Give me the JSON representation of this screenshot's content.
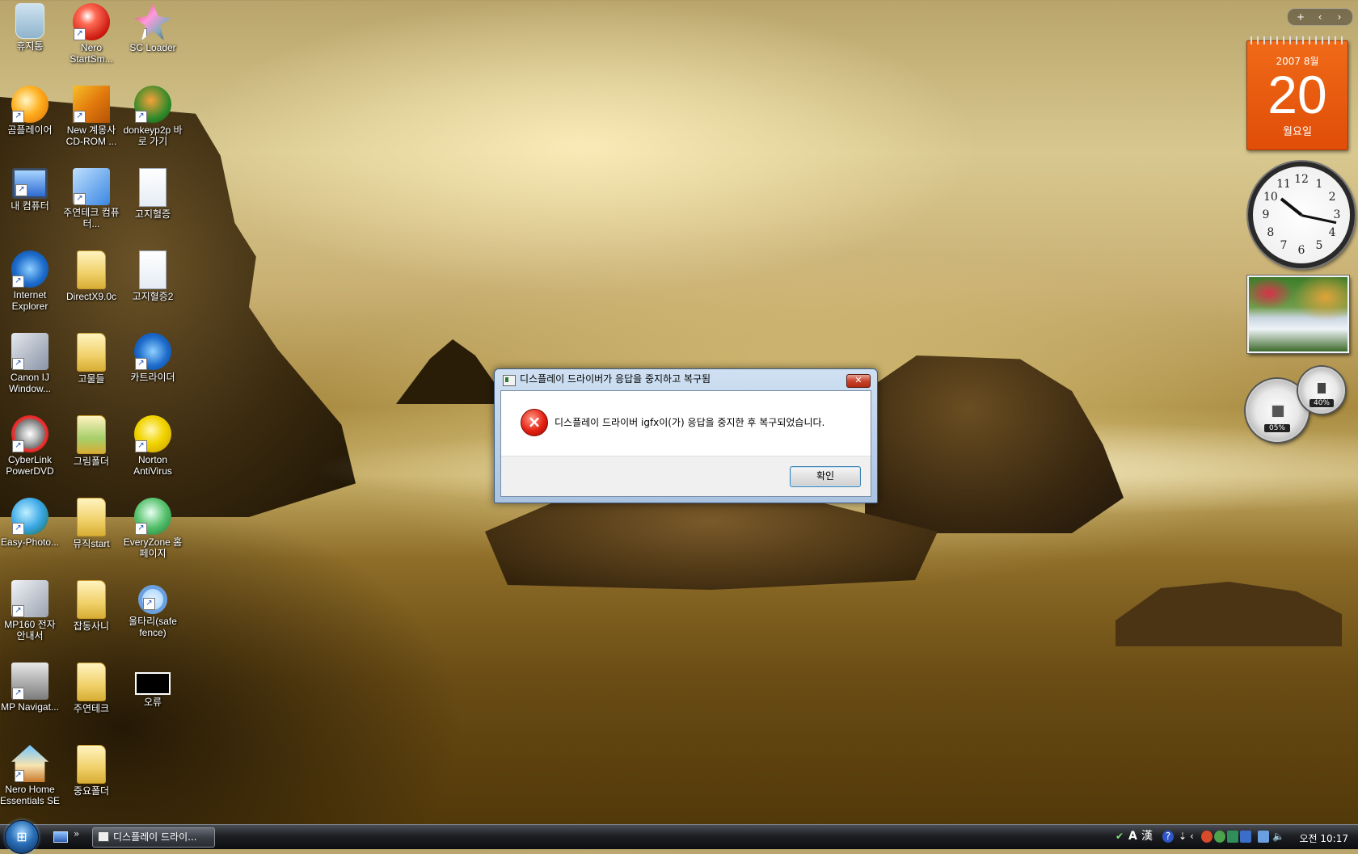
{
  "desktop": {
    "icons": [
      {
        "label": "휴지통",
        "glyph": "recycle-bin-icon"
      },
      {
        "label": "Nero StartSm...",
        "glyph": "nero-icon"
      },
      {
        "label": "SC Loader",
        "glyph": "sc-loader-icon"
      },
      {
        "label": "곰플레이어",
        "glyph": "gom-player-icon"
      },
      {
        "label": "New 계몽사 CD-ROM ...",
        "glyph": "cd-rom-icon"
      },
      {
        "label": "donkeyp2p 바로 가기",
        "glyph": "donkey-icon"
      },
      {
        "label": "내 컴퓨터",
        "glyph": "computer-icon"
      },
      {
        "label": "주연테크 컴퓨터...",
        "glyph": "help-icon"
      },
      {
        "label": "고지혈증",
        "glyph": "document-icon"
      },
      {
        "label": "Internet Explorer",
        "glyph": "internet-explorer-icon"
      },
      {
        "label": "DirectX9.0c",
        "glyph": "folder-icon"
      },
      {
        "label": "고지혈증2",
        "glyph": "document-icon"
      },
      {
        "label": "Canon IJ Window...",
        "glyph": "canon-printer-icon"
      },
      {
        "label": "고물들",
        "glyph": "folder-icon"
      },
      {
        "label": "카트라이더",
        "glyph": "internet-explorer-icon"
      },
      {
        "label": "CyberLink PowerDVD",
        "glyph": "cyberlink-icon"
      },
      {
        "label": "그림폴더",
        "glyph": "picture-folder-icon"
      },
      {
        "label": "Norton AntiVirus",
        "glyph": "norton-icon"
      },
      {
        "label": "Easy-Photo...",
        "glyph": "easy-photo-icon"
      },
      {
        "label": "뮤직start",
        "glyph": "folder-icon"
      },
      {
        "label": "EveryZone 홈페이지",
        "glyph": "everyzone-icon"
      },
      {
        "label": "MP160 전자 안내서",
        "glyph": "manual-icon"
      },
      {
        "label": "잡동사니",
        "glyph": "folder-icon"
      },
      {
        "label": "울타리(safe fence)",
        "glyph": "magnifier-icon"
      },
      {
        "label": "MP Navigat...",
        "glyph": "printer-icon"
      },
      {
        "label": "주연테크",
        "glyph": "folder-icon"
      },
      {
        "label": "오류",
        "glyph": "error-window-icon"
      },
      {
        "label": "Nero Home Essentials SE",
        "glyph": "nero-home-icon"
      },
      {
        "label": "중요폴더",
        "glyph": "folder-icon"
      }
    ]
  },
  "gadgets": {
    "toolbar": {
      "add": "+",
      "prev": "‹",
      "next": "›"
    },
    "calendar": {
      "year_month": "2007 8월",
      "day": "20",
      "weekday": "월요일"
    },
    "clock": {
      "numbers": [
        "12",
        "1",
        "2",
        "3",
        "4",
        "5",
        "6",
        "7",
        "8",
        "9",
        "10",
        "11"
      ],
      "time": "10:17"
    },
    "cpu_meter": {
      "cpu": "05%",
      "memory": "40%"
    }
  },
  "dialog": {
    "title": "디스플레이 드라이버가 응답을 중지하고 복구됨",
    "message": "디스플레이 드라이버 igfx이(가) 응답을 중지한 후 복구되었습니다.",
    "ok_label": "확인",
    "close_label": "✕"
  },
  "taskbar": {
    "task_label": "디스플레이 드라이...",
    "quick_more": "»",
    "tray": {
      "lang_a": "A",
      "lang_han": "漢",
      "help": "?",
      "chevron": "‹",
      "clock": "오전 10:17"
    }
  },
  "colors": {
    "calendar_orange": "#e8560e",
    "taskbar_dark": "#1d1f23",
    "dialog_frame": "#a9c3e0"
  }
}
